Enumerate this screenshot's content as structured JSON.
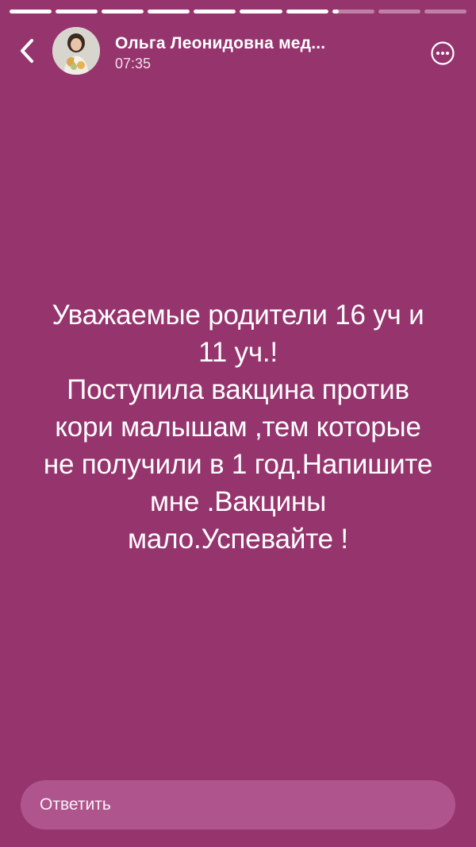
{
  "story_progress": {
    "segments": [
      {
        "filled": 1
      },
      {
        "filled": 1
      },
      {
        "filled": 1
      },
      {
        "filled": 1
      },
      {
        "filled": 1
      },
      {
        "filled": 1
      },
      {
        "filled": 1
      },
      {
        "filled": 0.15
      },
      {
        "filled": 0
      },
      {
        "filled": 0
      }
    ]
  },
  "header": {
    "back_icon": "chevron-left-icon",
    "author_name": "Ольга Леонидовна мед...",
    "time": "07:35",
    "more_icon": "ellipsis-circle-icon"
  },
  "story": {
    "background_color": "#96346e",
    "text": "Уважаемые родители 16 уч и\n11 уч.!\nПоступила вакцина против\nкори малышам ,тем которые\nне получили в 1 год.Напишите\nмне .Вакцины\nмало.Успевайте !"
  },
  "reply": {
    "placeholder": "Ответить"
  }
}
